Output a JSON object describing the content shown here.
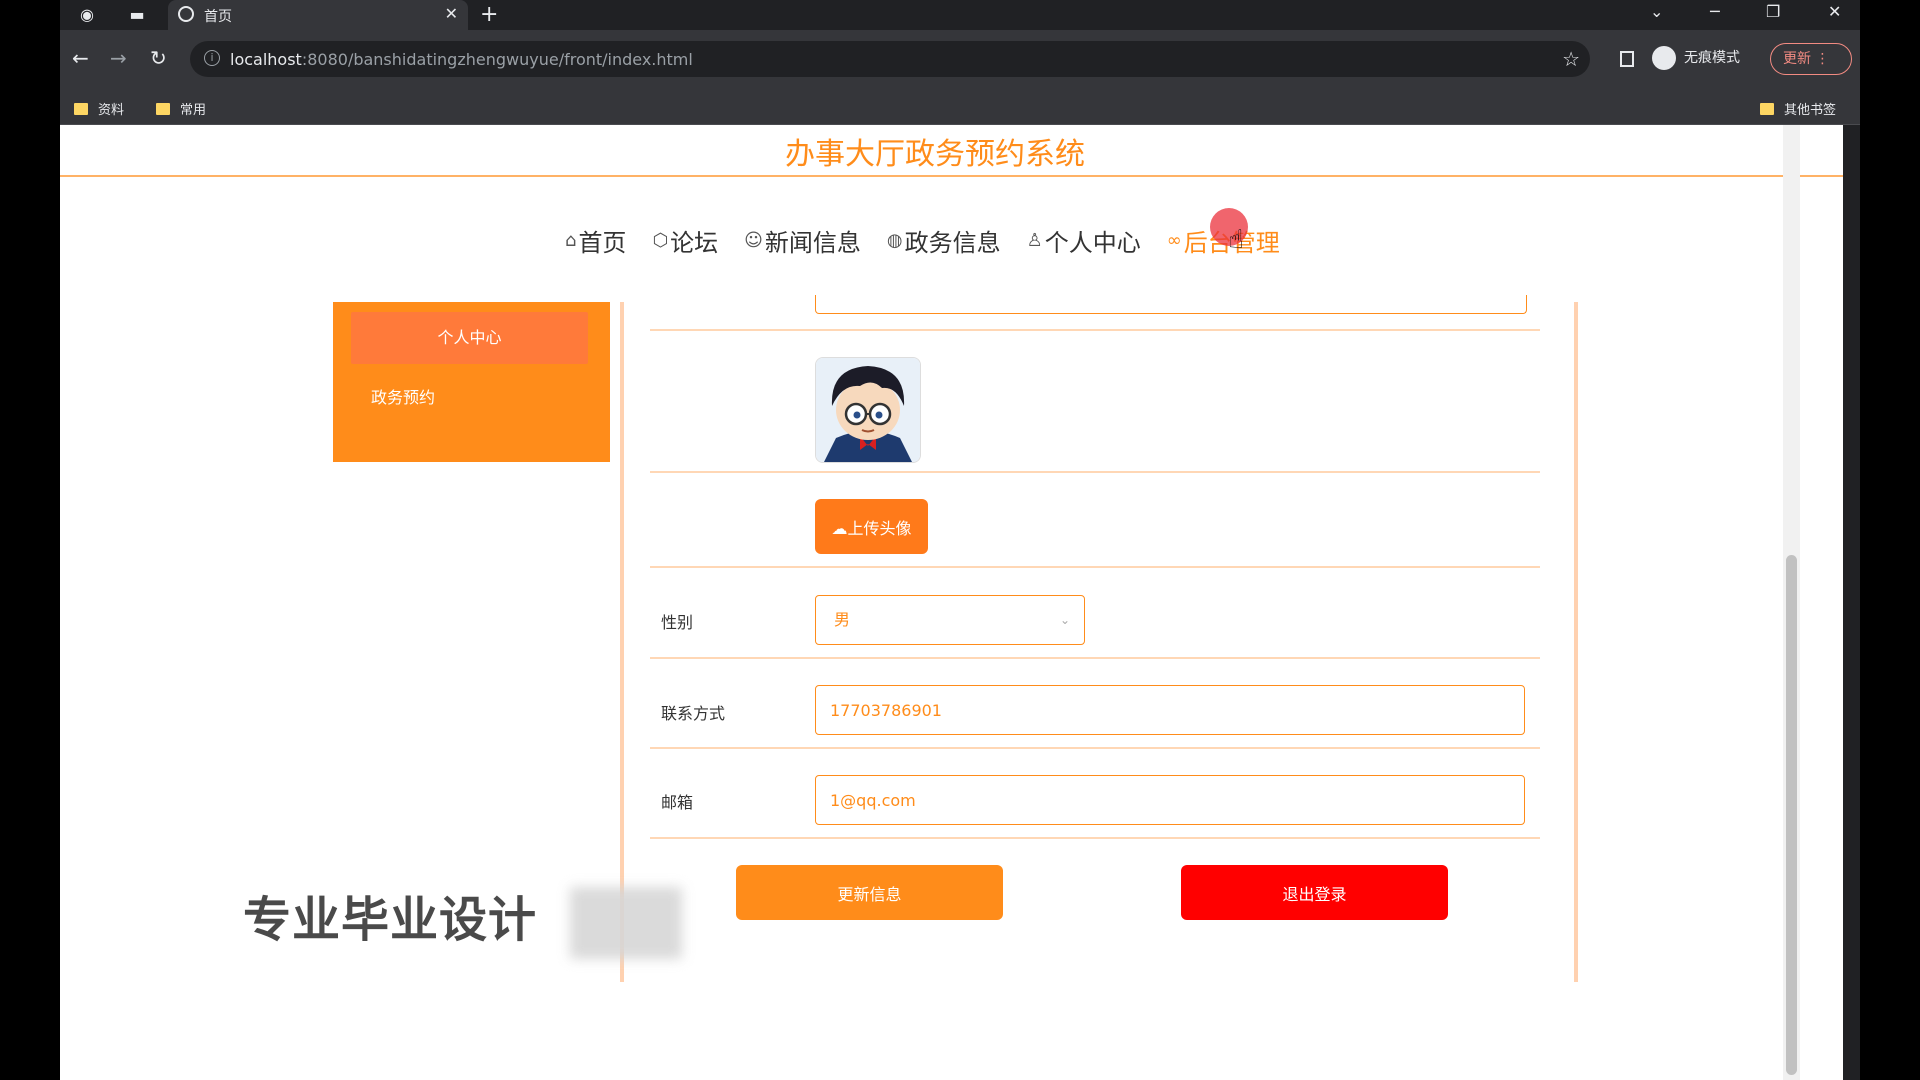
{
  "browser": {
    "tab_title": "首页",
    "url_host": "localhost",
    "url_rest": ":8080/banshidatingzhengwuyue/front/index.html",
    "incognito_label": "无痕模式",
    "update_label": "更新",
    "bookmarks": [
      "资料",
      "常用"
    ],
    "other_bookmarks": "其他书签"
  },
  "site": {
    "title": "办事大厅政务预约系统",
    "nav": [
      {
        "label": "首页",
        "icon": "home-icon"
      },
      {
        "label": "论坛",
        "icon": "cube-icon"
      },
      {
        "label": "新闻信息",
        "icon": "palette-icon"
      },
      {
        "label": "政务信息",
        "icon": "globe-icon"
      },
      {
        "label": "个人中心",
        "icon": "user-icon"
      },
      {
        "label": "后台管理",
        "icon": "link-icon"
      }
    ]
  },
  "sidebar": {
    "active": "个人中心",
    "items": [
      "政务预约"
    ]
  },
  "form": {
    "upload_label": "上传头像",
    "gender_label": "性别",
    "gender_value": "男",
    "contact_label": "联系方式",
    "contact_value": "17703786901",
    "email_label": "邮箱",
    "email_value": "1@qq.com",
    "update_button": "更新信息",
    "logout_button": "退出登录"
  },
  "watermark": "专业毕业设计",
  "colors": {
    "accent": "#ff8c1a",
    "danger": "#ff0000"
  }
}
